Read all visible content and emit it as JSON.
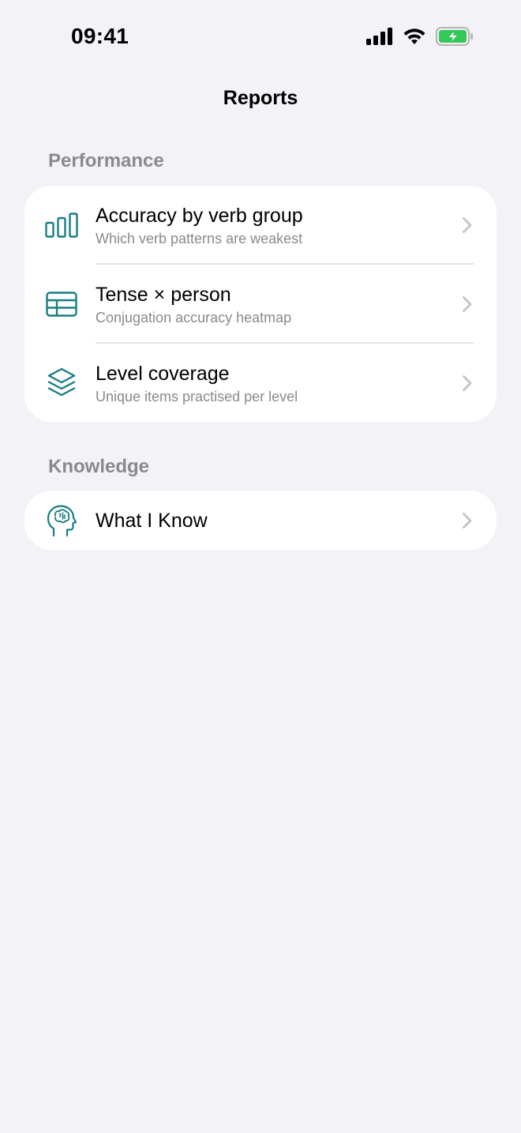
{
  "status_bar": {
    "time": "09:41",
    "icons": [
      "cellular-signal-icon",
      "wifi-icon",
      "battery-charging-icon"
    ]
  },
  "nav": {
    "title": "Reports"
  },
  "sections": [
    {
      "header": "Performance",
      "rows": [
        {
          "icon": "bar-chart-icon",
          "title": "Accuracy by verb group",
          "subtitle": "Which verb patterns are weakest"
        },
        {
          "icon": "table-grid-icon",
          "title": "Tense × person",
          "subtitle": "Conjugation accuracy heatmap"
        },
        {
          "icon": "layers-icon",
          "title": "Level coverage",
          "subtitle": "Unique items practised per level"
        }
      ]
    },
    {
      "header": "Knowledge",
      "rows": [
        {
          "icon": "brain-head-icon",
          "title": "What I Know"
        }
      ]
    }
  ],
  "colors": {
    "background": "#F2F2F7",
    "card": "#FFFFFF",
    "accent_teal": "#177E82",
    "secondary_text": "#8A8A8E",
    "chevron": "#C4C4C7",
    "battery_green": "#34C759"
  }
}
